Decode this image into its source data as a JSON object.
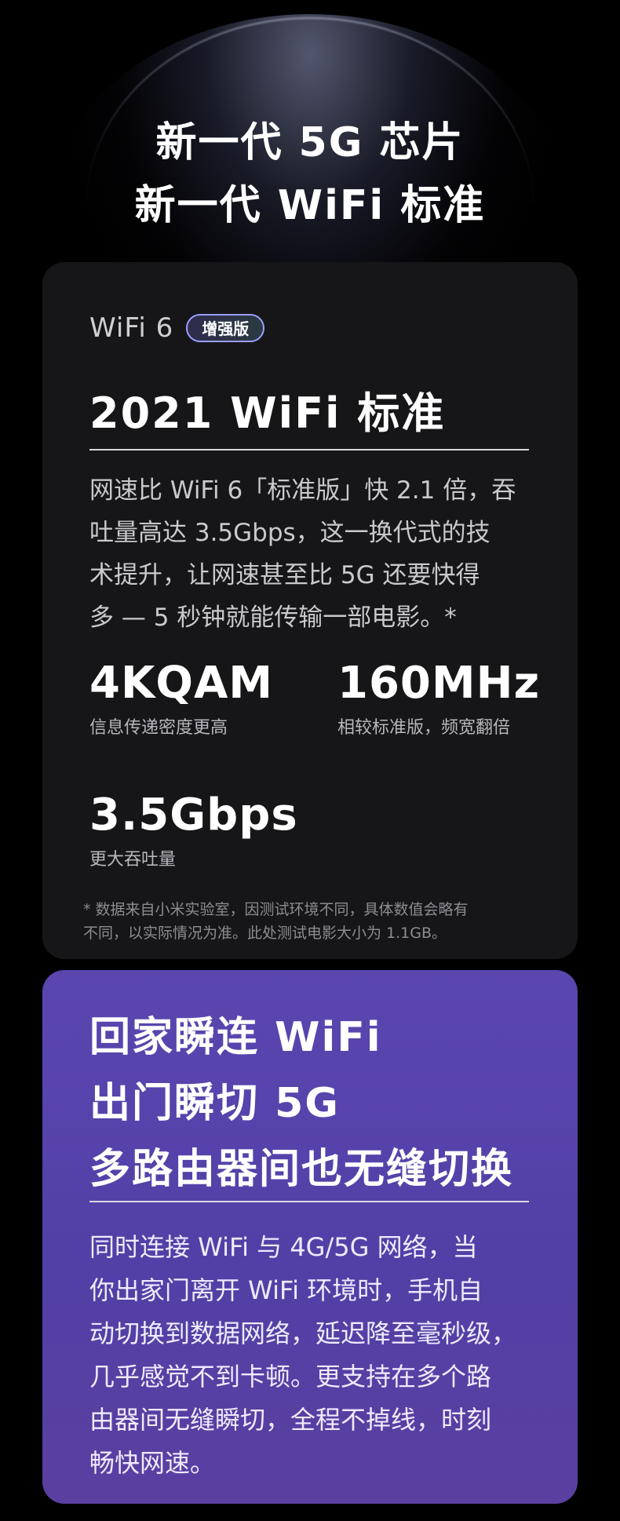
{
  "hero": {
    "title_line1": "新一代 5G 芯片",
    "title_line2": "新一代 WiFi 标准"
  },
  "wifi_card": {
    "wifi_label": "WiFi 6",
    "badge": "增强版",
    "title": "2021  WiFi 标准",
    "description_lines": [
      "网速比 WiFi 6「标准版」快 2.1 倍，吞",
      "吐量高达 3.5Gbps，这一换代式的技",
      "术提升，让网速甚至比 5G 还要快得",
      "多 — 5 秒钟就能传输一部电影。*"
    ],
    "stats": [
      {
        "value": "4KQAM",
        "caption": "信息传递密度更高"
      },
      {
        "value": "160MHz",
        "caption": "相较标准版，频宽翻倍"
      },
      {
        "value": "3.5Gbps",
        "caption": "更大吞吐量"
      }
    ],
    "footnote_lines": [
      "* 数据来自小米实验室，因测试环境不同，具体数值会略有",
      "不同，以实际情况为准。此处测试电影大小为 1.1GB。"
    ]
  },
  "switch_card": {
    "title_lines": [
      "回家瞬连 WiFi",
      "出门瞬切 5G",
      "多路由器间也无缝切换"
    ],
    "description_lines": [
      "同时连接 WiFi 与 4G/5G 网络，当",
      "你出家门离开 WiFi 环境时，手机自",
      "动切换到数据网络，延迟降至毫秒级，",
      "几乎感觉不到卡顿。更支持在多个路",
      "由器间无缝瞬切，全程不掉线，时刻",
      "畅快网速。"
    ]
  },
  "colors": {
    "background": "#000000",
    "dark_card": "#161618",
    "purple_card": "#5240a6",
    "badge_border": "#9aa0ff"
  }
}
